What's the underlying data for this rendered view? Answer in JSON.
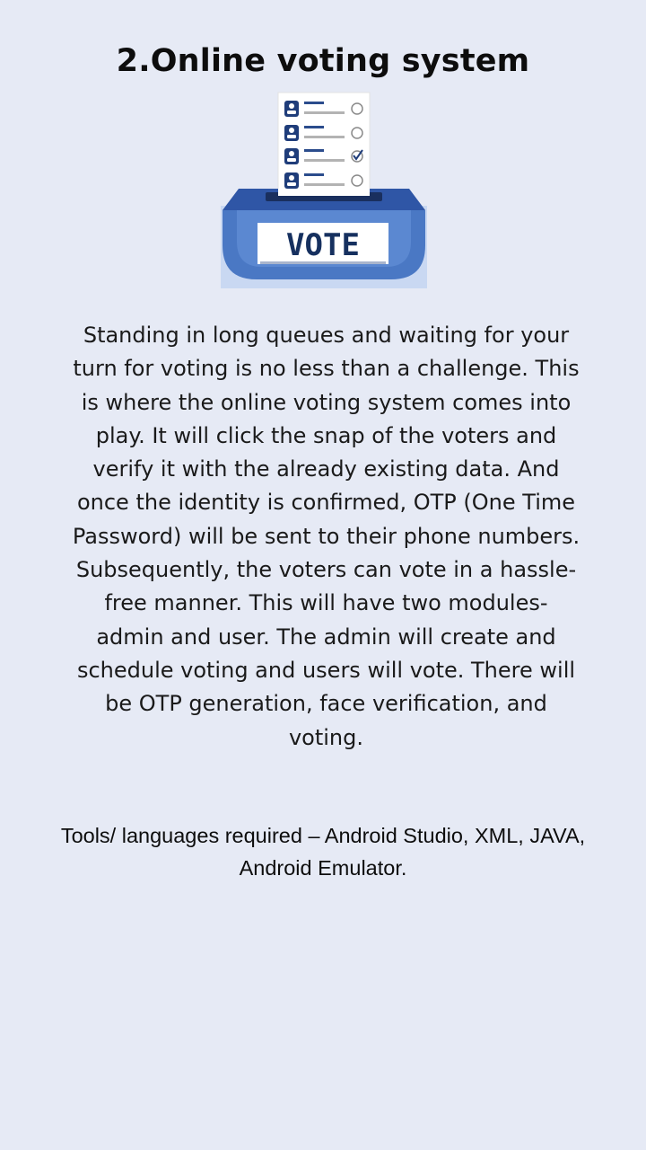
{
  "title": "2.Online voting system",
  "illustration": {
    "icon": "ballot-box-icon",
    "box_label": "VOTE",
    "colors": {
      "box": "#4a78c4",
      "box_dark": "#2f56a6",
      "label": "#16305f",
      "backdrop": "#c9d8f2"
    }
  },
  "description": "Standing in long queues and waiting for your turn for voting is no less than a challenge. This is where the online voting system comes into play. It will click the snap of the voters and verify it with the already existing data. And once the identity is confirmed, OTP (One Time Password) will be sent to their phone numbers. Subsequently, the voters can vote in a hassle-free manner. This will have two modules- admin and user. The admin will create and schedule voting and users will vote. There will be OTP generation, face verification, and voting.",
  "tools": "Tools/ languages required – Android Studio, XML, JAVA, Android Emulator."
}
